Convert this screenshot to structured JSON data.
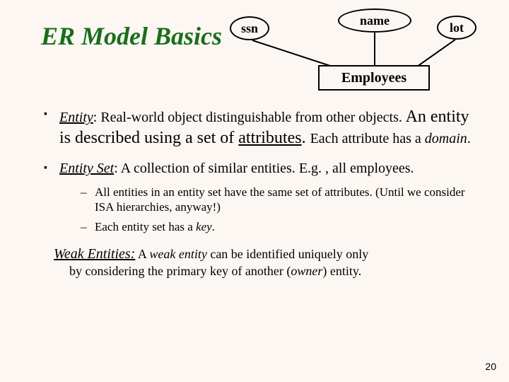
{
  "title": "ER Model Basics",
  "diagram": {
    "attrs": {
      "ssn": "ssn",
      "name": "name",
      "lot": "lot"
    },
    "entity": "Employees"
  },
  "bullet1": {
    "term": "Entity",
    "colon": ":  ",
    "t1": "Real-world object distinguishable from other objects.",
    "t2": " An entity is described using a set of ",
    "attr_word": "attributes",
    "t3": ". ",
    "t4": "Each attribute has a ",
    "domain_word": "domain",
    "t5": "."
  },
  "bullet2": {
    "term": "Entity Set",
    "colon": ":  ",
    "rest": "A collection of similar entities.  E.g. , all employees."
  },
  "sub": {
    "a": "All entities in an entity set have the same set of attributes.  (Until we consider ISA hierarchies, anyway!)",
    "b_pre": "Each entity set has a ",
    "b_key": "key",
    "b_post": "."
  },
  "weak": {
    "head": "Weak Entities:",
    "t1": " A ",
    "w": "weak entity",
    "t2": " can be identified uniquely only",
    "body_pre": "by considering the primary key of another (",
    "owner": "owner",
    "body_post": ") entity."
  },
  "pagenum": "20"
}
